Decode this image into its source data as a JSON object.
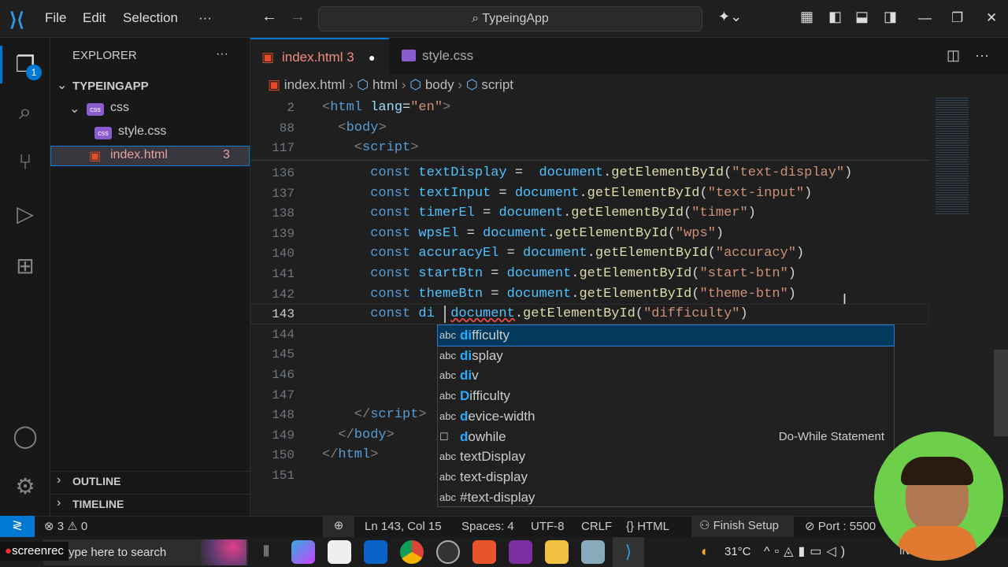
{
  "titlebar": {
    "menus": [
      "File",
      "Edit",
      "Selection",
      "···"
    ],
    "search": "TypeingApp"
  },
  "activity": {
    "explorer_badge": "1"
  },
  "sidebar": {
    "title": "EXPLORER",
    "project": "TYPEINGAPP",
    "folder": "css",
    "files": [
      {
        "name": "style.css",
        "badge": ""
      },
      {
        "name": "index.html",
        "badge": "3"
      }
    ],
    "outline": "OUTLINE",
    "timeline": "TIMELINE"
  },
  "tabs": [
    {
      "label": "index.html",
      "badge": "3",
      "dirty": true
    },
    {
      "label": "style.css"
    }
  ],
  "breadcrumb": [
    "index.html",
    "html",
    "body",
    "script"
  ],
  "sticky": [
    {
      "n": "2",
      "tokens": [
        [
          "g",
          "<"
        ],
        [
          "t",
          "html"
        ],
        [
          "a",
          " lang"
        ],
        [
          "p",
          "="
        ],
        [
          "s",
          "\"en\""
        ],
        [
          "g",
          ">"
        ]
      ],
      "indent": 0
    },
    {
      "n": "88",
      "tokens": [
        [
          "g",
          "<"
        ],
        [
          "t",
          "body"
        ],
        [
          "g",
          ">"
        ]
      ],
      "indent": 2
    },
    {
      "n": "117",
      "tokens": [
        [
          "g",
          "<"
        ],
        [
          "t",
          "script"
        ],
        [
          "g",
          ">"
        ]
      ],
      "indent": 4
    }
  ],
  "lines": [
    {
      "n": "136",
      "indent": 6,
      "tokens": [
        [
          "k",
          "const "
        ],
        [
          "v",
          "textDisplay"
        ],
        [
          "p",
          " =  "
        ],
        [
          "v",
          "document"
        ],
        [
          "p",
          "."
        ],
        [
          "f",
          "getElementById"
        ],
        [
          "p",
          "("
        ],
        [
          "s",
          "\"text-display\""
        ],
        [
          "p",
          ")"
        ]
      ]
    },
    {
      "n": "137",
      "indent": 6,
      "tokens": [
        [
          "k",
          "const "
        ],
        [
          "v",
          "textInput"
        ],
        [
          "p",
          " = "
        ],
        [
          "v",
          "document"
        ],
        [
          "p",
          "."
        ],
        [
          "f",
          "getElementById"
        ],
        [
          "p",
          "("
        ],
        [
          "s",
          "\"text-input\""
        ],
        [
          "p",
          ")"
        ]
      ]
    },
    {
      "n": "138",
      "indent": 6,
      "tokens": [
        [
          "k",
          "const "
        ],
        [
          "v",
          "timerEl"
        ],
        [
          "p",
          " = "
        ],
        [
          "v",
          "document"
        ],
        [
          "p",
          "."
        ],
        [
          "f",
          "getElementById"
        ],
        [
          "p",
          "("
        ],
        [
          "s",
          "\"timer\""
        ],
        [
          "p",
          ")"
        ]
      ]
    },
    {
      "n": "139",
      "indent": 6,
      "tokens": [
        [
          "k",
          "const "
        ],
        [
          "v",
          "wpsEl"
        ],
        [
          "p",
          " = "
        ],
        [
          "v",
          "document"
        ],
        [
          "p",
          "."
        ],
        [
          "f",
          "getElementById"
        ],
        [
          "p",
          "("
        ],
        [
          "s",
          "\"wps\""
        ],
        [
          "p",
          ")"
        ]
      ]
    },
    {
      "n": "140",
      "indent": 6,
      "tokens": [
        [
          "k",
          "const "
        ],
        [
          "v",
          "accuracyEl"
        ],
        [
          "p",
          " = "
        ],
        [
          "v",
          "document"
        ],
        [
          "p",
          "."
        ],
        [
          "f",
          "getElementById"
        ],
        [
          "p",
          "("
        ],
        [
          "s",
          "\"accuracy\""
        ],
        [
          "p",
          ")"
        ]
      ]
    },
    {
      "n": "141",
      "indent": 6,
      "tokens": [
        [
          "k",
          "const "
        ],
        [
          "v",
          "startBtn"
        ],
        [
          "p",
          " = "
        ],
        [
          "v",
          "document"
        ],
        [
          "p",
          "."
        ],
        [
          "f",
          "getElementById"
        ],
        [
          "p",
          "("
        ],
        [
          "s",
          "\"start-btn\""
        ],
        [
          "p",
          ")"
        ]
      ]
    },
    {
      "n": "142",
      "indent": 6,
      "tokens": [
        [
          "k",
          "const "
        ],
        [
          "v",
          "themeBtn"
        ],
        [
          "p",
          " = "
        ],
        [
          "v",
          "document"
        ],
        [
          "p",
          "."
        ],
        [
          "f",
          "getElementById"
        ],
        [
          "p",
          "("
        ],
        [
          "s",
          "\"theme-btn\""
        ],
        [
          "p",
          ")"
        ]
      ]
    },
    {
      "n": "143",
      "indent": 6,
      "tokens": [
        [
          "k",
          "const "
        ],
        [
          "v",
          "di"
        ],
        [
          "p",
          "  "
        ],
        [
          "v",
          "document"
        ],
        [
          "p",
          "."
        ],
        [
          "f",
          "getElementById"
        ],
        [
          "p",
          "("
        ],
        [
          "s",
          "\"difficulty\""
        ],
        [
          "p",
          ")"
        ]
      ]
    },
    {
      "n": "144",
      "indent": 0,
      "tokens": []
    },
    {
      "n": "145",
      "indent": 0,
      "tokens": []
    },
    {
      "n": "146",
      "indent": 0,
      "tokens": []
    },
    {
      "n": "147",
      "indent": 0,
      "tokens": []
    },
    {
      "n": "148",
      "indent": 4,
      "tokens": [
        [
          "g",
          "</"
        ],
        [
          "t",
          "script"
        ],
        [
          "g",
          ">"
        ]
      ]
    },
    {
      "n": "149",
      "indent": 2,
      "tokens": [
        [
          "g",
          "</"
        ],
        [
          "t",
          "body"
        ],
        [
          "g",
          ">"
        ]
      ]
    },
    {
      "n": "150",
      "indent": 0,
      "tokens": [
        [
          "g",
          "</"
        ],
        [
          "t",
          "html"
        ],
        [
          "g",
          ">"
        ]
      ]
    },
    {
      "n": "151",
      "indent": 0,
      "tokens": []
    }
  ],
  "suggest": {
    "items": [
      {
        "icon": "abc",
        "match": "di",
        "rest": "fficulty"
      },
      {
        "icon": "abc",
        "match": "di",
        "rest": "splay"
      },
      {
        "icon": "abc",
        "match": "di",
        "rest": "v"
      },
      {
        "icon": "abc",
        "match": "D",
        "rest": "ifficulty"
      },
      {
        "icon": "abc",
        "match": "d",
        "rest": "evice-width"
      },
      {
        "icon": "☐",
        "match": "d",
        "rest": "owhile"
      },
      {
        "icon": "abc",
        "match": "",
        "rest": "textDisplay"
      },
      {
        "icon": "abc",
        "match": "",
        "rest": "text-display"
      },
      {
        "icon": "abc",
        "match": "",
        "rest": "#text-display"
      }
    ],
    "detail": "Do-While Statement"
  },
  "status": {
    "errors": "3",
    "warnings": "0",
    "position": "Ln 143, Col 15",
    "spaces": "Spaces: 4",
    "encoding": "UTF-8",
    "eol": "CRLF",
    "language": "HTML",
    "finish": "Finish Setup",
    "port": "Port : 5500"
  },
  "taskbar": {
    "search": "ype here to search",
    "recorder": "screenrec",
    "weather": "31°C",
    "lang": "IN"
  }
}
